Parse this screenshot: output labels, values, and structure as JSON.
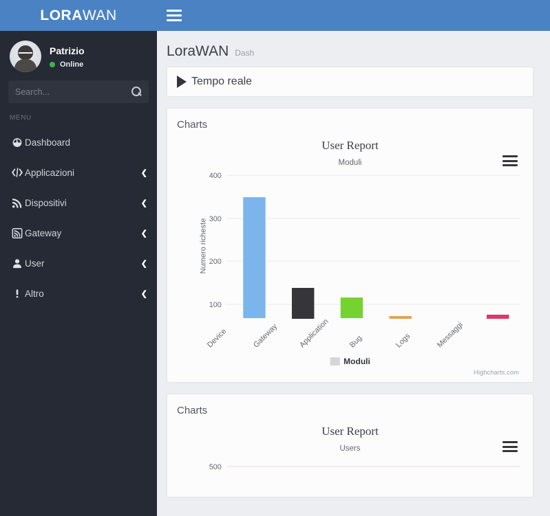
{
  "brand": {
    "strong": "LORA",
    "light": "WAN"
  },
  "navbar": {
    "toggle_icon": "hamburger-icon"
  },
  "sidebar": {
    "profile": {
      "name": "Patrizio",
      "status": "Online",
      "status_color": "#3bb54a",
      "avatar_icon": "user-avatar"
    },
    "search": {
      "value": "",
      "placeholder": "Search...",
      "icon": "search-icon"
    },
    "menu_heading": "MENU",
    "items": [
      {
        "label": "Dashboard",
        "icon": "dashboard-icon",
        "glyph": "☸",
        "arrow": ""
      },
      {
        "label": "Applicazioni",
        "icon": "code-icon",
        "glyph": "‹/›",
        "arrow": "❮"
      },
      {
        "label": "Dispositivi",
        "icon": "rss-icon",
        "glyph": "⦸",
        "arrow": "❮"
      },
      {
        "label": "Gateway",
        "icon": "rss-square-icon",
        "glyph": "▣",
        "arrow": "❮"
      },
      {
        "label": "User",
        "icon": "user-icon",
        "glyph": "♟",
        "arrow": "❮"
      },
      {
        "label": "Altro",
        "icon": "exclamation-icon",
        "glyph": "❗",
        "arrow": "❮"
      }
    ]
  },
  "page": {
    "title": "LoraWAN",
    "subtitle": "Dash"
  },
  "realtime": {
    "label": "Tempo reale",
    "icon": "play-icon"
  },
  "panels": [
    {
      "heading": "Charts"
    },
    {
      "heading": "Charts"
    }
  ],
  "colors": {
    "header_blue": "#4a82c4",
    "sidebar_dark": "#252a34",
    "content_bg": "#eceef1",
    "panel_bg": "#fcfcfd"
  },
  "chart_data": [
    {
      "type": "bar",
      "title": "User Report",
      "subtitle": "Moduli",
      "xlabel": "",
      "ylabel": "Numero richeste",
      "categories": [
        "Device",
        "Gateway",
        "Application",
        "Bug",
        "Logs",
        "Messaggi"
      ],
      "series": [
        {
          "name": "Moduli",
          "low": [
            67,
            65,
            67,
            67,
            0,
            67
          ],
          "high": [
            348,
            137,
            115,
            71,
            0,
            73
          ],
          "colors": [
            "#7cb5ec",
            "#36353a",
            "#75d330",
            "#e0a458",
            "#8085e9",
            "#d63b6e"
          ]
        }
      ],
      "ylim": [
        0,
        400
      ],
      "yticks": [
        0,
        100,
        200,
        300,
        400
      ],
      "grid": true,
      "legend": {
        "position": "bottom",
        "entries": [
          "Moduli"
        ]
      },
      "credit": "Highcharts.com",
      "context_menu_icon": "hamburger-menu-icon"
    },
    {
      "type": "bar",
      "title": "User Report",
      "subtitle": "Users",
      "xlabel": "",
      "ylabel": "",
      "categories": [],
      "series": [],
      "ylim": [
        0,
        500
      ],
      "yticks": [
        500
      ],
      "grid": true,
      "legend": {
        "position": "bottom",
        "entries": []
      },
      "credit": "",
      "context_menu_icon": "hamburger-menu-icon"
    }
  ]
}
